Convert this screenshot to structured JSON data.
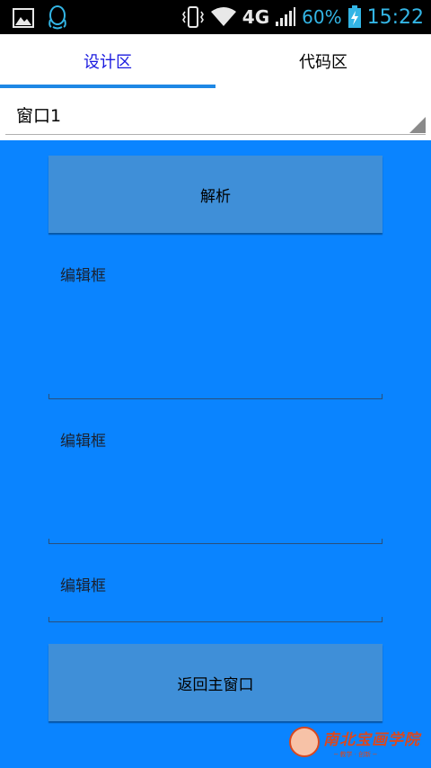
{
  "status_bar": {
    "network": "4G",
    "battery": "60%",
    "time": "15:22",
    "icons": [
      "image-icon",
      "qq-icon",
      "vibrate-icon",
      "wifi-icon",
      "signal-icon",
      "battery-charging-icon"
    ]
  },
  "tabs": [
    {
      "label": "设计区",
      "active": true
    },
    {
      "label": "代码区",
      "active": false
    }
  ],
  "spinner": {
    "value": "窗口1"
  },
  "design": {
    "parse_button": "解析",
    "edit_boxes": [
      "编辑框",
      "编辑框",
      "编辑框"
    ],
    "back_button": "返回主窗口"
  },
  "watermark": {
    "text": "南北宝画学院",
    "sub": "─ 教学 · 创新 ─"
  },
  "colors": {
    "accent": "#1e88e5",
    "canvas": "#0a84ff",
    "button": "#3f8fd8",
    "status": "#33b5e5"
  }
}
